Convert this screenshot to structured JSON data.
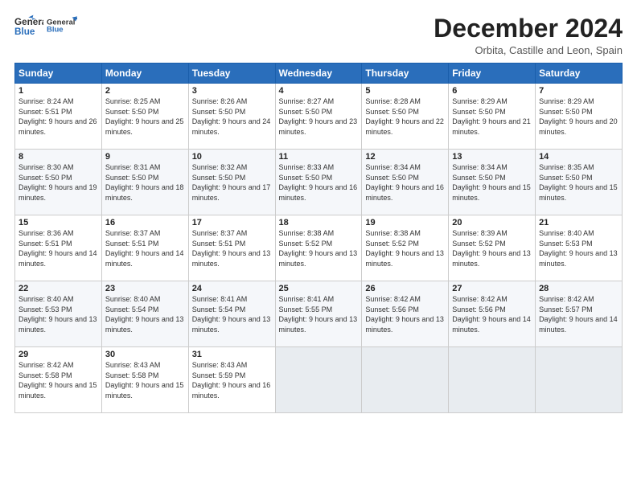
{
  "header": {
    "logo_general": "General",
    "logo_blue": "Blue",
    "month_title": "December 2024",
    "location": "Orbita, Castille and Leon, Spain"
  },
  "weekdays": [
    "Sunday",
    "Monday",
    "Tuesday",
    "Wednesday",
    "Thursday",
    "Friday",
    "Saturday"
  ],
  "weeks": [
    [
      {
        "day": "1",
        "sunrise": "8:24 AM",
        "sunset": "5:51 PM",
        "daylight": "9 hours and 26 minutes."
      },
      {
        "day": "2",
        "sunrise": "8:25 AM",
        "sunset": "5:50 PM",
        "daylight": "9 hours and 25 minutes."
      },
      {
        "day": "3",
        "sunrise": "8:26 AM",
        "sunset": "5:50 PM",
        "daylight": "9 hours and 24 minutes."
      },
      {
        "day": "4",
        "sunrise": "8:27 AM",
        "sunset": "5:50 PM",
        "daylight": "9 hours and 23 minutes."
      },
      {
        "day": "5",
        "sunrise": "8:28 AM",
        "sunset": "5:50 PM",
        "daylight": "9 hours and 22 minutes."
      },
      {
        "day": "6",
        "sunrise": "8:29 AM",
        "sunset": "5:50 PM",
        "daylight": "9 hours and 21 minutes."
      },
      {
        "day": "7",
        "sunrise": "8:29 AM",
        "sunset": "5:50 PM",
        "daylight": "9 hours and 20 minutes."
      }
    ],
    [
      {
        "day": "8",
        "sunrise": "8:30 AM",
        "sunset": "5:50 PM",
        "daylight": "9 hours and 19 minutes."
      },
      {
        "day": "9",
        "sunrise": "8:31 AM",
        "sunset": "5:50 PM",
        "daylight": "9 hours and 18 minutes."
      },
      {
        "day": "10",
        "sunrise": "8:32 AM",
        "sunset": "5:50 PM",
        "daylight": "9 hours and 17 minutes."
      },
      {
        "day": "11",
        "sunrise": "8:33 AM",
        "sunset": "5:50 PM",
        "daylight": "9 hours and 16 minutes."
      },
      {
        "day": "12",
        "sunrise": "8:34 AM",
        "sunset": "5:50 PM",
        "daylight": "9 hours and 16 minutes."
      },
      {
        "day": "13",
        "sunrise": "8:34 AM",
        "sunset": "5:50 PM",
        "daylight": "9 hours and 15 minutes."
      },
      {
        "day": "14",
        "sunrise": "8:35 AM",
        "sunset": "5:50 PM",
        "daylight": "9 hours and 15 minutes."
      }
    ],
    [
      {
        "day": "15",
        "sunrise": "8:36 AM",
        "sunset": "5:51 PM",
        "daylight": "9 hours and 14 minutes."
      },
      {
        "day": "16",
        "sunrise": "8:37 AM",
        "sunset": "5:51 PM",
        "daylight": "9 hours and 14 minutes."
      },
      {
        "day": "17",
        "sunrise": "8:37 AM",
        "sunset": "5:51 PM",
        "daylight": "9 hours and 13 minutes."
      },
      {
        "day": "18",
        "sunrise": "8:38 AM",
        "sunset": "5:52 PM",
        "daylight": "9 hours and 13 minutes."
      },
      {
        "day": "19",
        "sunrise": "8:38 AM",
        "sunset": "5:52 PM",
        "daylight": "9 hours and 13 minutes."
      },
      {
        "day": "20",
        "sunrise": "8:39 AM",
        "sunset": "5:52 PM",
        "daylight": "9 hours and 13 minutes."
      },
      {
        "day": "21",
        "sunrise": "8:40 AM",
        "sunset": "5:53 PM",
        "daylight": "9 hours and 13 minutes."
      }
    ],
    [
      {
        "day": "22",
        "sunrise": "8:40 AM",
        "sunset": "5:53 PM",
        "daylight": "9 hours and 13 minutes."
      },
      {
        "day": "23",
        "sunrise": "8:40 AM",
        "sunset": "5:54 PM",
        "daylight": "9 hours and 13 minutes."
      },
      {
        "day": "24",
        "sunrise": "8:41 AM",
        "sunset": "5:54 PM",
        "daylight": "9 hours and 13 minutes."
      },
      {
        "day": "25",
        "sunrise": "8:41 AM",
        "sunset": "5:55 PM",
        "daylight": "9 hours and 13 minutes."
      },
      {
        "day": "26",
        "sunrise": "8:42 AM",
        "sunset": "5:56 PM",
        "daylight": "9 hours and 13 minutes."
      },
      {
        "day": "27",
        "sunrise": "8:42 AM",
        "sunset": "5:56 PM",
        "daylight": "9 hours and 14 minutes."
      },
      {
        "day": "28",
        "sunrise": "8:42 AM",
        "sunset": "5:57 PM",
        "daylight": "9 hours and 14 minutes."
      }
    ],
    [
      {
        "day": "29",
        "sunrise": "8:42 AM",
        "sunset": "5:58 PM",
        "daylight": "9 hours and 15 minutes."
      },
      {
        "day": "30",
        "sunrise": "8:43 AM",
        "sunset": "5:58 PM",
        "daylight": "9 hours and 15 minutes."
      },
      {
        "day": "31",
        "sunrise": "8:43 AM",
        "sunset": "5:59 PM",
        "daylight": "9 hours and 16 minutes."
      },
      null,
      null,
      null,
      null
    ]
  ]
}
